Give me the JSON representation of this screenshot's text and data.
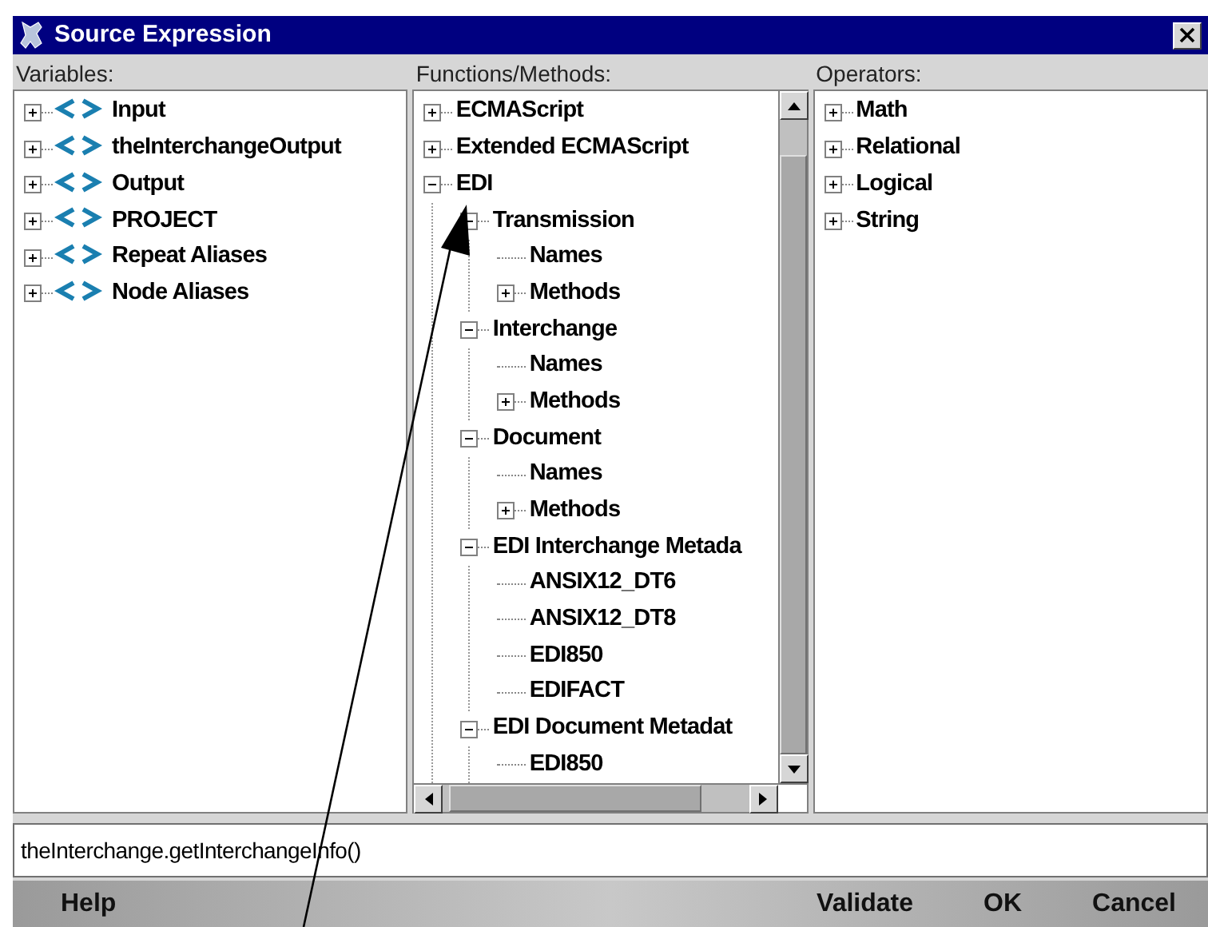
{
  "window": {
    "title": "Source Expression"
  },
  "panels": [
    {
      "label": "Variables:",
      "icons": true,
      "scrollbars": false,
      "items": [
        {
          "label": "Input",
          "expanded": false
        },
        {
          "label": "theInterchangeOutput",
          "expanded": false
        },
        {
          "label": "Output",
          "expanded": false
        },
        {
          "label": "PROJECT",
          "expanded": false
        },
        {
          "label": "Repeat Aliases",
          "expanded": false
        },
        {
          "label": "Node Aliases",
          "expanded": false
        }
      ]
    },
    {
      "label": "Functions/Methods:",
      "icons": false,
      "scrollbars": true,
      "items": [
        {
          "label": "ECMAScript",
          "expanded": false
        },
        {
          "label": "Extended ECMAScript",
          "expanded": false
        },
        {
          "label": "EDI",
          "expanded": true,
          "children": [
            {
              "label": "Transmission",
              "expanded": true,
              "children": [
                {
                  "label": "Names"
                },
                {
                  "label": "Methods",
                  "expanded": false
                }
              ]
            },
            {
              "label": "Interchange",
              "expanded": true,
              "children": [
                {
                  "label": "Names"
                },
                {
                  "label": "Methods",
                  "expanded": false
                }
              ]
            },
            {
              "label": "Document",
              "expanded": true,
              "children": [
                {
                  "label": "Names"
                },
                {
                  "label": "Methods",
                  "expanded": false
                }
              ]
            },
            {
              "label": "EDI Interchange Metada",
              "expanded": true,
              "children": [
                {
                  "label": "ANSIX12_DT6"
                },
                {
                  "label": "ANSIX12_DT8"
                },
                {
                  "label": "EDI850"
                },
                {
                  "label": "EDIFACT"
                }
              ]
            },
            {
              "label": "EDI Document Metadat",
              "expanded": true,
              "children": [
                {
                  "label": "EDI850"
                }
              ]
            }
          ]
        }
      ]
    },
    {
      "label": "Operators:",
      "icons": false,
      "scrollbars": false,
      "items": [
        {
          "label": "Math",
          "expanded": false
        },
        {
          "label": "Relational",
          "expanded": false
        },
        {
          "label": "Logical",
          "expanded": false
        },
        {
          "label": "String",
          "expanded": false
        }
      ]
    }
  ],
  "expression": {
    "value": "theInterchange.getInterchangeInfo()"
  },
  "buttons": [
    "Help",
    "Validate",
    "OK",
    "Cancel"
  ]
}
